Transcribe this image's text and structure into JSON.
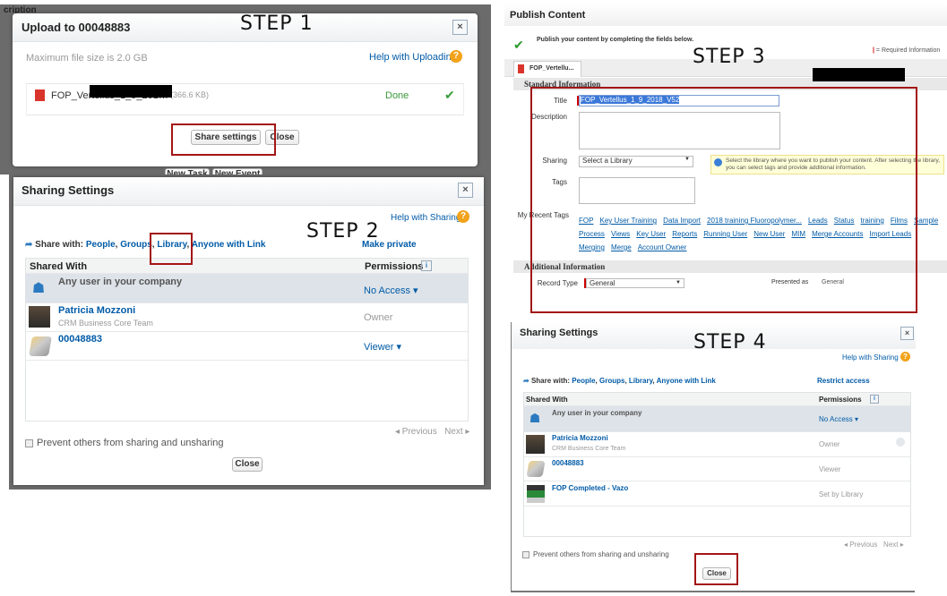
{
  "step1": {
    "step_label": "STEP 1",
    "bg_text_top": "cription",
    "bg_buttons": [
      "New Task",
      "New Event"
    ],
    "title": "Upload to 00048883",
    "close": "×",
    "max_size": "Maximum file size is 2.0 GB",
    "help": "Help with Uploading",
    "help_icon": "?",
    "file_name": "FOP_Vertellus_1_9_201…",
    "file_size": "(366.6 KB)",
    "status": "Done",
    "share_button": "Share settings",
    "close_button": "Close"
  },
  "step2": {
    "step_label": "STEP 2",
    "title": "Sharing Settings",
    "close": "×",
    "help": "Help with Sharing",
    "help_icon": "?",
    "share_with_label": "Share with:",
    "share_options": [
      "People",
      "Groups",
      "Library",
      "Anyone with Link"
    ],
    "make_private": "Make private",
    "columns": [
      "Shared With",
      "Permissions"
    ],
    "rows": [
      {
        "name": "Any user in your company",
        "sub": "",
        "permission": "No Access ▾"
      },
      {
        "name": "Patricia Mozzoni",
        "sub": "CRM Business Core Team",
        "permission": "Owner"
      },
      {
        "name": "00048883",
        "sub": "",
        "permission": "Viewer ▾"
      }
    ],
    "previous": "◂ Previous",
    "next": "Next ▸",
    "prevent": "Prevent others from sharing and unsharing",
    "close_button": "Close"
  },
  "step3": {
    "step_label": "STEP 3",
    "title": "Publish Content",
    "intro": "Publish your content by completing the fields below.",
    "required_note": "= Required Information",
    "tab": "FOP_Vertellu...",
    "standard_section": "Standard Information",
    "title_label": "Title",
    "title_value": "FOP_Vertellus_1_9_2018_V52",
    "description_label": "Description",
    "sharing_label": "Sharing",
    "sharing_value": "Select a Library",
    "sharing_tip": "Select the library where you want to publish your content. After selecting the library, you can select tags and provide additional information.",
    "tags_label": "Tags",
    "recent_tags_label": "My Recent Tags",
    "recent_tags": [
      "FOP",
      "Key User Training",
      "Data Import",
      "2018 training Fluoropolymer...",
      "Leads",
      "Status",
      "training",
      "Films",
      "Sample Process",
      "Views",
      "Key User",
      "Reports",
      "Running User",
      "New User",
      "MIM",
      "Merge Accounts",
      "Import Leads",
      "Merging",
      "Merge",
      "Account Owner"
    ],
    "additional_section": "Additional Information",
    "record_type_label": "Record Type",
    "record_type_value": "General",
    "presented_as_label": "Presented as",
    "presented_as_value": "General"
  },
  "step4": {
    "step_label": "STEP 4",
    "title": "Sharing Settings",
    "close": "×",
    "help": "Help with Sharing",
    "help_icon": "?",
    "share_with_label": "Share with:",
    "share_options": [
      "People",
      "Groups",
      "Library",
      "Anyone with Link"
    ],
    "restrict": "Restrict access",
    "columns": [
      "Shared With",
      "Permissions"
    ],
    "rows": [
      {
        "name": "Any user in your company",
        "sub": "",
        "permission": "No Access ▾"
      },
      {
        "name": "Patricia Mozzoni",
        "sub": "CRM Business Core Team",
        "permission": "Owner"
      },
      {
        "name": "00048883",
        "sub": "",
        "permission": "Viewer"
      },
      {
        "name": "FOP Completed - Vazo",
        "sub": "",
        "permission": "Set by Library"
      }
    ],
    "previous": "◂ Previous",
    "next": "Next ▸",
    "prevent": "Prevent others from sharing and unsharing",
    "close_button": "Close"
  },
  "colors": {
    "link": "#015ba7",
    "highlight": "#a31515",
    "help": "#f2a31b",
    "done": "#3a9a3a"
  }
}
